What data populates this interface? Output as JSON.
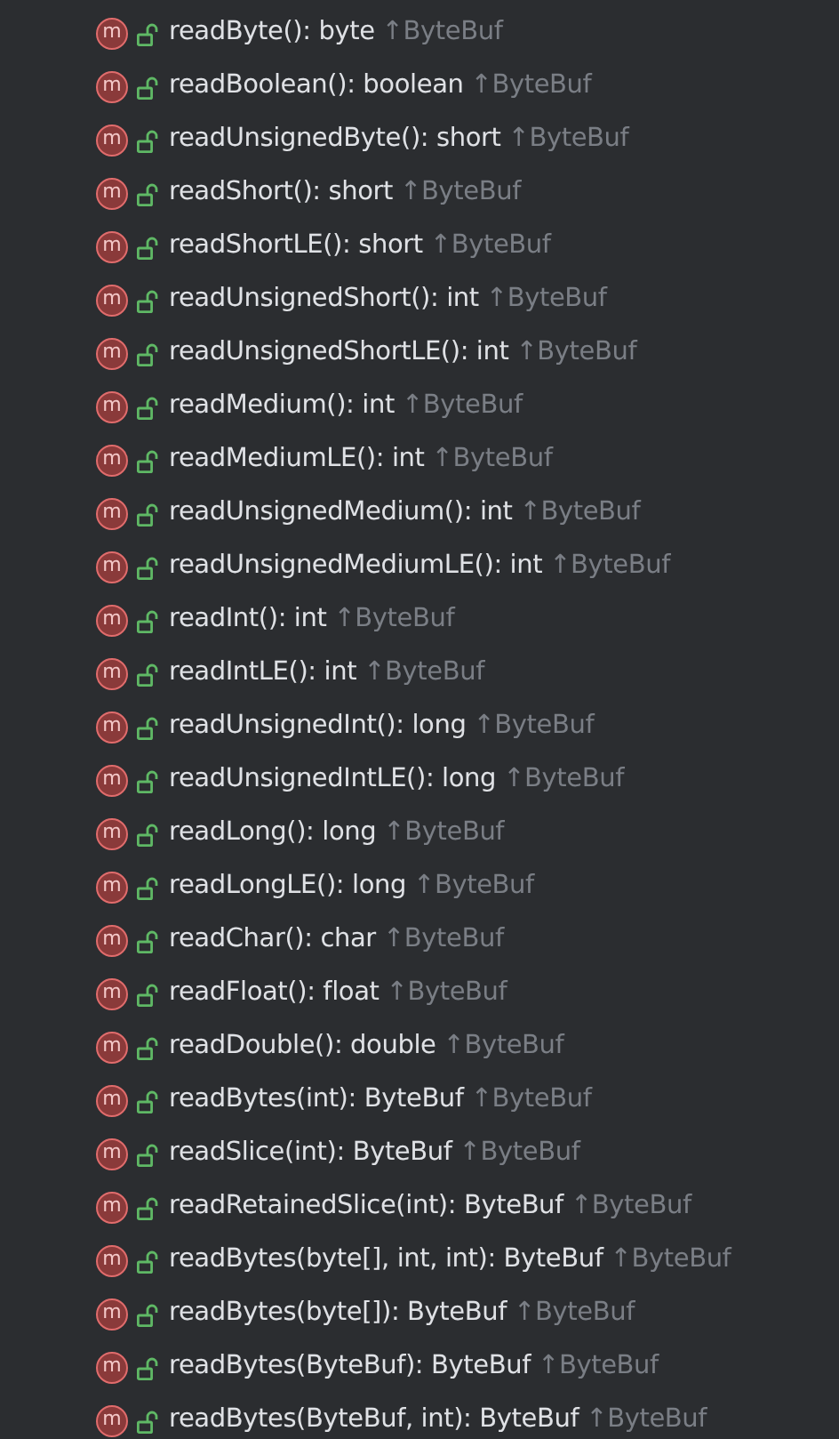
{
  "members": [
    {
      "badge": "m",
      "signature": "readByte(): byte",
      "origin": "↑ByteBuf"
    },
    {
      "badge": "m",
      "signature": "readBoolean(): boolean",
      "origin": "↑ByteBuf"
    },
    {
      "badge": "m",
      "signature": "readUnsignedByte(): short",
      "origin": "↑ByteBuf"
    },
    {
      "badge": "m",
      "signature": "readShort(): short",
      "origin": "↑ByteBuf"
    },
    {
      "badge": "m",
      "signature": "readShortLE(): short",
      "origin": "↑ByteBuf"
    },
    {
      "badge": "m",
      "signature": "readUnsignedShort(): int",
      "origin": "↑ByteBuf"
    },
    {
      "badge": "m",
      "signature": "readUnsignedShortLE(): int",
      "origin": "↑ByteBuf"
    },
    {
      "badge": "m",
      "signature": "readMedium(): int",
      "origin": "↑ByteBuf"
    },
    {
      "badge": "m",
      "signature": "readMediumLE(): int",
      "origin": "↑ByteBuf"
    },
    {
      "badge": "m",
      "signature": "readUnsignedMedium(): int",
      "origin": "↑ByteBuf"
    },
    {
      "badge": "m",
      "signature": "readUnsignedMediumLE(): int",
      "origin": "↑ByteBuf"
    },
    {
      "badge": "m",
      "signature": "readInt(): int",
      "origin": "↑ByteBuf"
    },
    {
      "badge": "m",
      "signature": "readIntLE(): int",
      "origin": "↑ByteBuf"
    },
    {
      "badge": "m",
      "signature": "readUnsignedInt(): long",
      "origin": "↑ByteBuf"
    },
    {
      "badge": "m",
      "signature": "readUnsignedIntLE(): long",
      "origin": "↑ByteBuf"
    },
    {
      "badge": "m",
      "signature": "readLong(): long",
      "origin": "↑ByteBuf"
    },
    {
      "badge": "m",
      "signature": "readLongLE(): long",
      "origin": "↑ByteBuf"
    },
    {
      "badge": "m",
      "signature": "readChar(): char",
      "origin": "↑ByteBuf"
    },
    {
      "badge": "m",
      "signature": "readFloat(): float",
      "origin": "↑ByteBuf"
    },
    {
      "badge": "m",
      "signature": "readDouble(): double",
      "origin": "↑ByteBuf"
    },
    {
      "badge": "m",
      "signature": "readBytes(int): ByteBuf",
      "origin": "↑ByteBuf"
    },
    {
      "badge": "m",
      "signature": "readSlice(int): ByteBuf",
      "origin": "↑ByteBuf"
    },
    {
      "badge": "m",
      "signature": "readRetainedSlice(int): ByteBuf",
      "origin": "↑ByteBuf"
    },
    {
      "badge": "m",
      "signature": "readBytes(byte[], int, int): ByteBuf",
      "origin": "↑ByteBuf"
    },
    {
      "badge": "m",
      "signature": "readBytes(byte[]): ByteBuf",
      "origin": "↑ByteBuf"
    },
    {
      "badge": "m",
      "signature": "readBytes(ByteBuf): ByteBuf",
      "origin": "↑ByteBuf"
    },
    {
      "badge": "m",
      "signature": "readBytes(ByteBuf, int): ByteBuf",
      "origin": "↑ByteBuf"
    }
  ]
}
